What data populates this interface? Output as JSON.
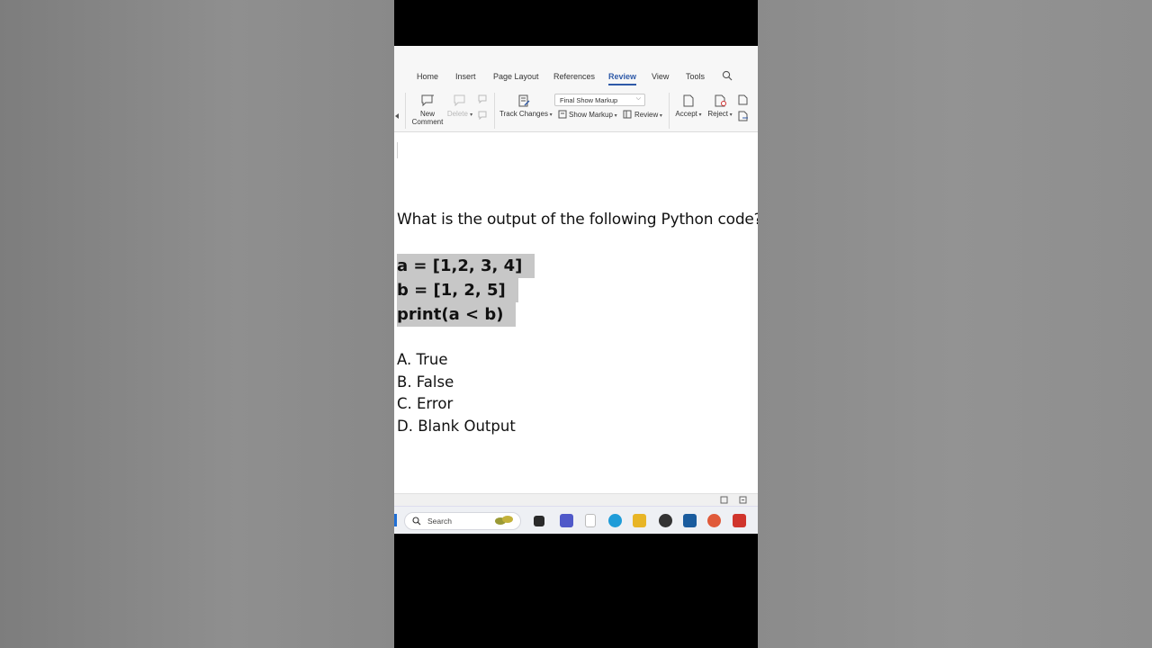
{
  "ribbon": {
    "tabs": [
      "Home",
      "Insert",
      "Page Layout",
      "References",
      "Review",
      "View",
      "Tools"
    ],
    "active_tab": "Review",
    "new_comment_line1": "New",
    "new_comment_line2": "Comment",
    "delete_label": "Delete",
    "track_changes_label": "Track Changes",
    "markup_mode": "Final Show Markup",
    "show_markup_label": "Show Markup",
    "review_label": "Review",
    "accept_label": "Accept",
    "reject_label": "Reject"
  },
  "document": {
    "question": "What is the output of the following Python code?",
    "code_lines": [
      "a = [1,2, 3, 4]",
      "b = [1, 2, 5]",
      "print(a < b)"
    ],
    "options": [
      "A. True",
      "B. False",
      "C. Error",
      "D. Blank Output"
    ]
  },
  "taskbar": {
    "search_placeholder": "Search"
  },
  "colors": {
    "accent": "#2f5aa8",
    "code_highlight": "#c7c7c7"
  }
}
